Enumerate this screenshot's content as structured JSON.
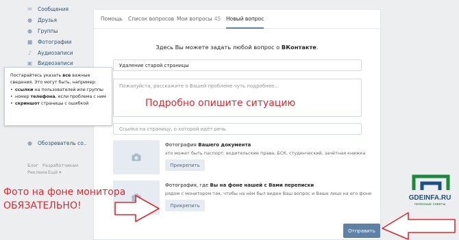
{
  "sidebar": {
    "items": [
      {
        "label": "Сообщения",
        "icon": "message-icon"
      },
      {
        "label": "Друзья",
        "icon": "friends-icon"
      },
      {
        "label": "Группы",
        "icon": "groups-icon"
      },
      {
        "label": "Фотографии",
        "icon": "camera-icon"
      },
      {
        "label": "Аудиозаписи",
        "icon": "music-icon"
      },
      {
        "label": "Видеозаписи",
        "icon": "video-icon"
      },
      {
        "label": "Обозреватель со..",
        "icon": "group-app-icon"
      }
    ],
    "footer_links": [
      "Блог",
      "Разработчикам",
      "Реклама",
      "Ещё"
    ]
  },
  "hint": {
    "intro": "Постарайтесь указать",
    "intro_bold": "все",
    "intro_rest": "важные сведения. Это могут быть, например:",
    "items": [
      {
        "bold": "ссылки",
        "text": " на пользователей или группы"
      },
      {
        "prefix": "номер ",
        "bold": "телефона",
        "text": ", если проблема с ним"
      },
      {
        "bold": "скриншот",
        "text": " страницы с ошибкой"
      }
    ]
  },
  "tabs": [
    {
      "label": "Помощь"
    },
    {
      "label": "Список вопросов"
    },
    {
      "label": "Мои вопросы",
      "count": "45"
    },
    {
      "label": "Новый вопрос",
      "active": true
    }
  ],
  "form": {
    "heading": "Здесь Вы можете задать любой вопрос о",
    "heading_bold": "ВКонтакте",
    "subject_value": "Удаление старой страницы",
    "description_placeholder": "Пожалуйста, расскажите о Вашей проблеме чуть подробнее...",
    "link_placeholder": "Ссылка на страницу, о которой идёт речь",
    "upload1": {
      "title_normal": "Фотография",
      "title_bold": "Вашего документа",
      "desc": "это может быть паспорт, водительские права, БСК, студенческий, зачётная книжка",
      "button": "Прикрепить"
    },
    "upload2": {
      "title_normal": "Фотография, где",
      "title_bold": "Вы на фоне нашей с Вами переписки",
      "desc": "рядом с монитором так, чтобы на нём был виден Ваш вопрос и Ваше лицо на его фоне",
      "button": "Прикрепить"
    },
    "send_button": "Отправить"
  },
  "overlay": {
    "describe": "Подробно опишите ситуацию",
    "photo_line1": "Фото на фоне монитора",
    "photo_line2": "ОБЯЗАТЕЛЬНО!"
  },
  "watermark": {
    "title": "GDEINFA.RU",
    "subtitle": "полезные советы"
  },
  "colors": {
    "accent": "#5181b8",
    "button": "#5e81a8",
    "annotation_red": "#e3262b",
    "watermark_green": "#1b8a3a",
    "watermark_blue": "#1a4f8a"
  }
}
